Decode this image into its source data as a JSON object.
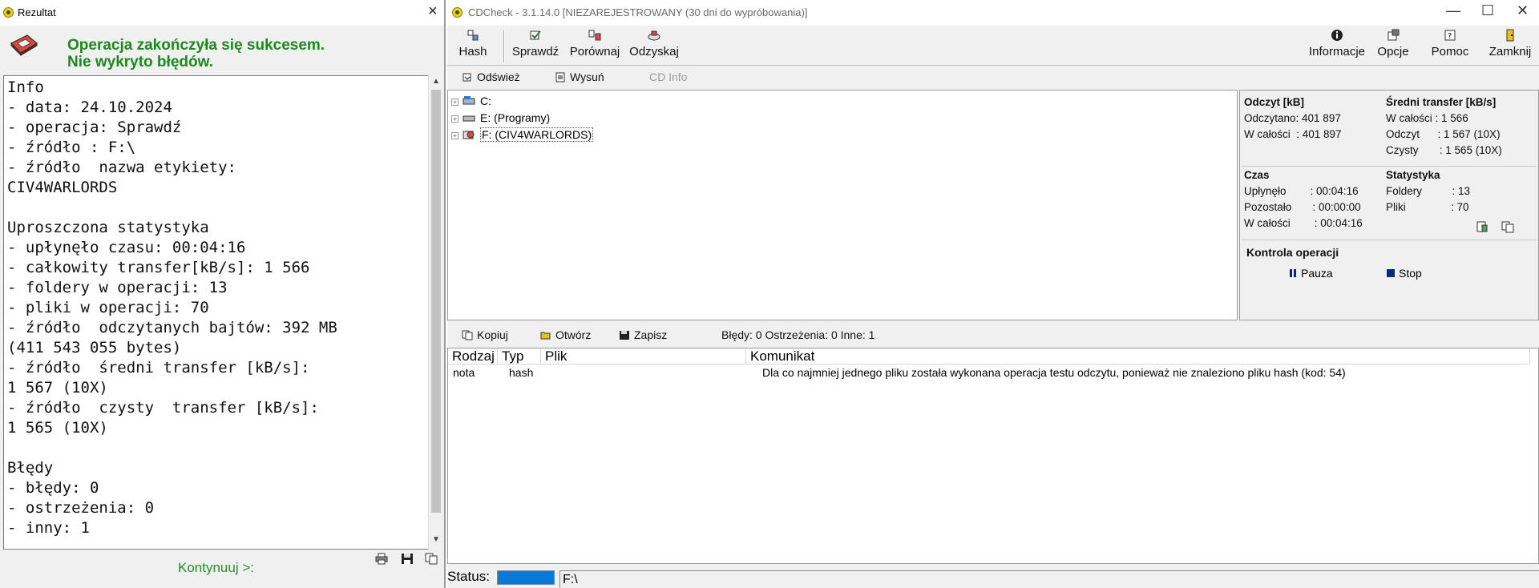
{
  "result_window": {
    "title": "Rezultat",
    "close_glyph": "×",
    "success_line1": "Operacja zakończyła się sukcesem.",
    "success_line2": "Nie wykryto błędów.",
    "report_text": "Info\n- data: 24.10.2024\n- operacja: Sprawdź\n- źródło : F:\\\n- źródło  nazwa etykiety:\nCIV4WARLORDS\n\nUproszczona statystyka\n- upłynęło czasu: 00:04:16\n- całkowity transfer[kB/s]: 1 566\n- foldery w operacji: 13\n- pliki w operacji: 70\n- źródło  odczytanych bajtów: 392 MB\n(411 543 055 bytes)\n- źródło  średni transfer [kB/s]:\n1 567 (10X)\n- źródło  czysty  transfer [kB/s]:\n1 565 (10X)\n\nBłędy\n- błędy: 0\n- ostrzeżenia: 0\n- inny: 1",
    "continue_label": "Kontynuuj >:",
    "icons": [
      "disk-icon",
      "printer-icon",
      "save-icon",
      "copy-icon"
    ]
  },
  "main_window": {
    "title": "CDCheck - 3.1.14.0 [NIEZAREJESTROWANY (30 dni do wypróbowania)]",
    "win_controls": {
      "minimize": "—",
      "maximize": "☐",
      "close": "✕"
    },
    "toolbar": {
      "hash": "Hash",
      "verify": "Sprawdź",
      "compare": "Porównaj",
      "recover": "Odzyskaj",
      "info": "Informacje",
      "options": "Opcje",
      "help": "Pomoc",
      "close": "Zamknij"
    },
    "toolbar2": {
      "refresh": "Odśwież",
      "eject": "Wysuń",
      "cdinfo": "CD Info"
    },
    "tree": [
      {
        "label": "C:",
        "icon": "drive-c-icon"
      },
      {
        "label": "E: (Programy)",
        "icon": "drive-e-icon"
      },
      {
        "label": "F: (CIV4WARLORDS)",
        "icon": "cd-drive-icon"
      }
    ],
    "stats": {
      "read_header": "Odczyt [kB]",
      "read_done": "Odczytano: 401 897",
      "read_total": "W całości  : 401 897",
      "transfer_header": "Średni transfer [kB/s]",
      "transfer_total": "W całości : 1 566",
      "transfer_read": "Odczyt      : 1 567 (10X)",
      "transfer_clean": "Czysty       : 1 565 (10X)",
      "time_header": "Czas",
      "elapsed": "Upłynęło        : 00:04:16",
      "remaining": "Pozostało       : 00:00:00",
      "time_total": "W całości        : 00:04:16",
      "statistics_header": "Statystyka",
      "folders": "Foldery          : 13",
      "files": "Pliki               : 70",
      "control_header": "Kontrola operacji",
      "pause": "Pauza",
      "stop": "Stop"
    },
    "bottom_toolbar": {
      "copy": "Kopiuj",
      "open": "Otwórz",
      "save": "Zapisz",
      "summary": "Błędy: 0 Ostrzeżenia: 0 Inne: 1"
    },
    "table": {
      "columns": [
        "Rodzaj",
        "Typ",
        "Plik",
        "Komunikat"
      ],
      "rows": [
        [
          "nota",
          "hash",
          "",
          "Dla co najmniej jednego pliku została wykonana operacja testu odczytu, ponieważ nie znaleziono pliku hash (kod: 54)"
        ]
      ]
    },
    "statusbar": {
      "label": "Status:",
      "progress_percent": 100,
      "path": "F:\\"
    }
  }
}
